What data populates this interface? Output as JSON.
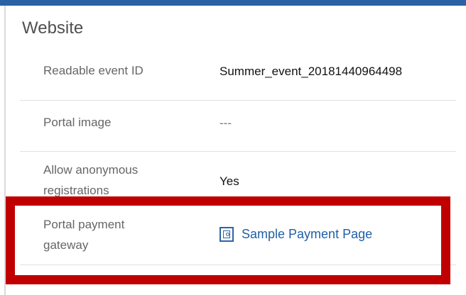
{
  "section": {
    "title": "Website"
  },
  "rows": [
    {
      "label": "Readable event ID",
      "value": "Summer_event_20181440964498"
    },
    {
      "label": "Portal image",
      "value": "---"
    },
    {
      "label": "Allow anonymous registrations",
      "value": "Yes"
    },
    {
      "label": "Portal payment gateway",
      "value": "Sample Payment Page",
      "icon": "entity-lookup-icon"
    }
  ],
  "colors": {
    "accent_bar": "#2b62a5",
    "highlight": "#c00000",
    "link": "#1f5fa9"
  }
}
